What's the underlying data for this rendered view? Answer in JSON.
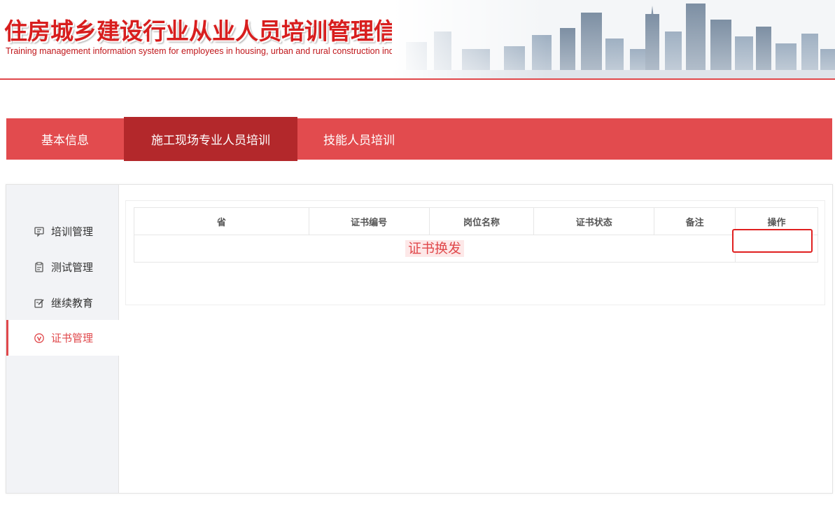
{
  "header": {
    "title_cn": "住房城乡建设行业从业人员培训管理信息系统",
    "title_en": "Training management information system for employees in housing, urban and rural construction industry",
    "accent_color": "#e0484b"
  },
  "topnav": {
    "tabs": [
      {
        "label": "基本信息",
        "active": false
      },
      {
        "label": "施工现场专业人员培训",
        "active": true
      },
      {
        "label": "技能人员培训",
        "active": false
      }
    ]
  },
  "sidebar": {
    "items": [
      {
        "label": "培训管理",
        "icon": "chat-icon",
        "active": false
      },
      {
        "label": "测试管理",
        "icon": "clipboard-icon",
        "active": false
      },
      {
        "label": "继续教育",
        "icon": "edit-icon",
        "active": false
      },
      {
        "label": "证书管理",
        "icon": "badge-icon",
        "active": true
      }
    ]
  },
  "table": {
    "columns": [
      "省",
      "证书编号",
      "岗位名称",
      "证书状态",
      "备注",
      "操作"
    ],
    "row_link": "证书换发"
  }
}
